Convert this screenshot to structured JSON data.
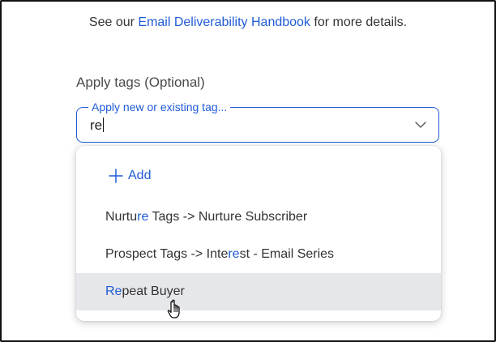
{
  "info": {
    "prefix": "See our ",
    "link": "Email Deliverability Handbook",
    "suffix": " for more details."
  },
  "tags": {
    "section_label": "Apply tags (Optional)",
    "floating_label": "Apply new or existing tag...",
    "input_value": "re",
    "add_label": "Add",
    "options": [
      {
        "parts": [
          "Nurtu",
          "re",
          " Tags -> Nurture Subscriber"
        ]
      },
      {
        "parts": [
          "Prospect Tags -> Inte",
          "re",
          "st - Email Series"
        ]
      },
      {
        "parts": [
          "",
          "Re",
          "peat Buyer"
        ]
      }
    ]
  },
  "colors": {
    "accent": "#1f5bd6",
    "hover": "#e6e7ea"
  },
  "icons": [
    "chevron-down-icon",
    "plus-icon",
    "hand-pointer-cursor-icon"
  ]
}
